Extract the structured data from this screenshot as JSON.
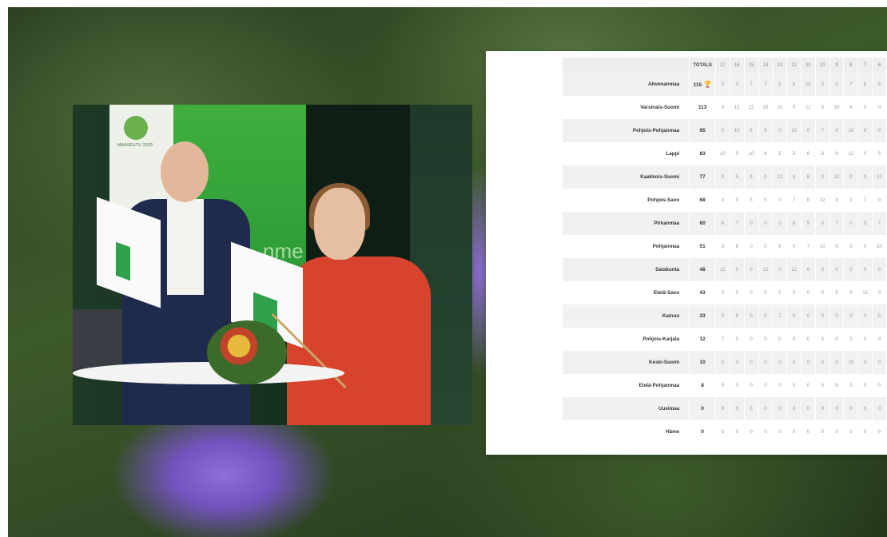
{
  "photo": {
    "banner_logo_text": "MAASEUTU 2020",
    "banner_word": "nme"
  },
  "score_table": {
    "totals_label": "TOTALS",
    "columns": [
      "17",
      "16",
      "15",
      "14",
      "13",
      "12",
      "11",
      "10",
      "9",
      "8",
      "7",
      "6"
    ],
    "rows": [
      {
        "name": "Ahvenanmaa",
        "total": "115",
        "trophy": true,
        "values": [
          "5",
          "0",
          "7",
          "7",
          "8",
          "6",
          "10",
          "0",
          "0",
          "7",
          "6",
          "6"
        ]
      },
      {
        "name": "Varsinais-Suomi",
        "total": "113",
        "values": [
          "0",
          "12",
          "12",
          "10",
          "10",
          "0",
          "12",
          "6",
          "10",
          "6",
          "0",
          "0"
        ]
      },
      {
        "name": "Pohjois-Pohjanmaa",
        "total": "95",
        "values": [
          "0",
          "10",
          "6",
          "8",
          "0",
          "10",
          "0",
          "7",
          "0",
          "10",
          "8",
          "8"
        ]
      },
      {
        "name": "Lappi",
        "total": "83",
        "values": [
          "10",
          "0",
          "10",
          "6",
          "5",
          "5",
          "6",
          "8",
          "6",
          "12",
          "0",
          "5"
        ]
      },
      {
        "name": "Kaakkois-Suomi",
        "total": "77",
        "values": [
          "0",
          "5",
          "8",
          "0",
          "12",
          "0",
          "8",
          "0",
          "12",
          "0",
          "0",
          "12"
        ]
      },
      {
        "name": "Pohjois-Savo",
        "total": "68",
        "values": [
          "0",
          "0",
          "5",
          "5",
          "0",
          "7",
          "0",
          "12",
          "8",
          "0",
          "7",
          "0"
        ]
      },
      {
        "name": "Pirkanmaa",
        "total": "60",
        "values": [
          "6",
          "7",
          "0",
          "0",
          "0",
          "8",
          "5",
          "0",
          "7",
          "0",
          "5",
          "7"
        ]
      },
      {
        "name": "Pohjanmaa",
        "total": "51",
        "values": [
          "0",
          "8",
          "0",
          "0",
          "6",
          "0",
          "7",
          "10",
          "0",
          "0",
          "0",
          "10"
        ]
      },
      {
        "name": "Satakunta",
        "total": "48",
        "values": [
          "12",
          "0",
          "0",
          "12",
          "0",
          "12",
          "0",
          "0",
          "0",
          "0",
          "0",
          "0"
        ]
      },
      {
        "name": "Etelä-Savo",
        "total": "43",
        "values": [
          "5",
          "0",
          "0",
          "0",
          "0",
          "0",
          "0",
          "0",
          "5",
          "5",
          "12",
          "0"
        ]
      },
      {
        "name": "Kainuu",
        "total": "33",
        "values": [
          "0",
          "6",
          "0",
          "0",
          "7",
          "0",
          "0",
          "0",
          "0",
          "0",
          "0",
          "0"
        ]
      },
      {
        "name": "Pohjois-Karjala",
        "total": "12",
        "values": [
          "7",
          "0",
          "0",
          "0",
          "0",
          "0",
          "0",
          "5",
          "0",
          "0",
          "0",
          "0"
        ]
      },
      {
        "name": "Keski-Suomi",
        "total": "10",
        "values": [
          "0",
          "0",
          "0",
          "0",
          "0",
          "0",
          "0",
          "0",
          "0",
          "10",
          "0",
          "0"
        ]
      },
      {
        "name": "Etelä-Pohjanmaa",
        "total": "8",
        "values": [
          "0",
          "0",
          "0",
          "0",
          "0",
          "0",
          "0",
          "0",
          "8",
          "0",
          "0",
          "0"
        ]
      },
      {
        "name": "Uusimaa",
        "total": "0",
        "values": [
          "0",
          "0",
          "0",
          "0",
          "0",
          "0",
          "0",
          "0",
          "0",
          "0",
          "0",
          "0"
        ]
      },
      {
        "name": "Häme",
        "total": "0",
        "values": [
          "0",
          "0",
          "0",
          "0",
          "0",
          "0",
          "0",
          "0",
          "0",
          "0",
          "0",
          "0"
        ]
      }
    ]
  }
}
